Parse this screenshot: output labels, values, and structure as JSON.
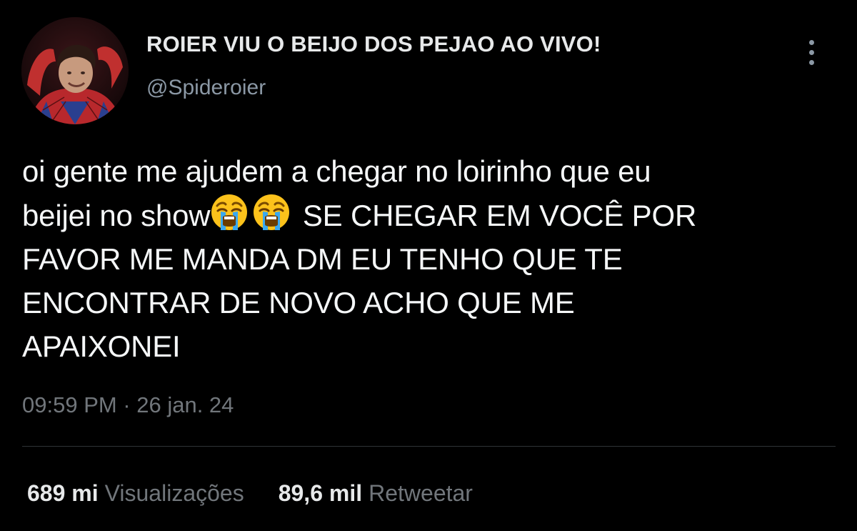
{
  "tweet": {
    "author": {
      "display_name": "ROIER VIU O BEIJO DOS PEJAO AO VIVO!",
      "handle": "@Spideroier"
    },
    "more_icon": "vertical-ellipsis-icon",
    "text_lines": [
      "oi gente me ajudem a chegar no loirinho que eu",
      "beijei no show",
      "SE CHEGAR EM VOCÊ POR",
      "FAVOR ME MANDA DM EU TENHO QUE TE",
      "ENCONTRAR DE NOVO ACHO QUE ME",
      "APAIXONEI"
    ],
    "emoji": [
      "loudly-crying-face-emoji",
      "loudly-crying-face-emoji"
    ],
    "timestamp": "09:59 PM · 26 jan. 24",
    "stats": {
      "views_count": "689 mi",
      "views_label": "Visualizações",
      "retweets_count": "89,6 mil",
      "retweets_label": "Retweetar"
    }
  },
  "colors": {
    "background": "#000000",
    "primary_text": "#e7e9ea",
    "secondary_text": "#71767b",
    "divider": "#2f3336"
  }
}
